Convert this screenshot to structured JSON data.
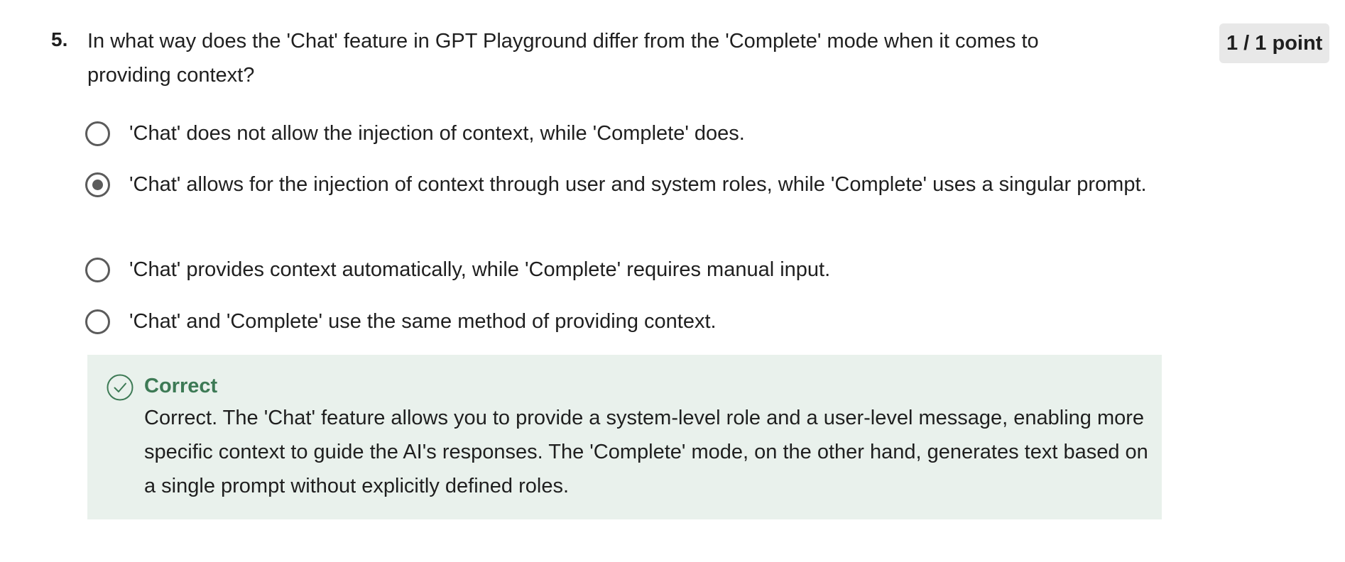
{
  "question": {
    "number": "5.",
    "text": "In what way does the 'Chat' feature in GPT Playground differ from the 'Complete' mode when it comes to providing context?",
    "points": "1 / 1 point"
  },
  "options": [
    {
      "label": "'Chat' does not allow the injection of context, while 'Complete' does.",
      "selected": false
    },
    {
      "label": "'Chat' allows for the injection of context through user and system roles, while 'Complete' uses a singular prompt.",
      "selected": true
    },
    {
      "label": "'Chat' provides context automatically, while 'Complete' requires manual input.",
      "selected": false
    },
    {
      "label": "'Chat' and 'Complete' use the same method of providing context.",
      "selected": false
    }
  ],
  "feedback": {
    "status": "Correct",
    "icon": "check-circle-icon",
    "text": "Correct. The 'Chat' feature allows you to provide a system-level role and a user-level message, enabling more specific context to guide the AI's responses. The 'Complete' mode, on the other hand, generates text based on a single prompt without explicitly defined roles.",
    "accent_color": "#3d7a55",
    "background_color": "#e9f1ec"
  }
}
